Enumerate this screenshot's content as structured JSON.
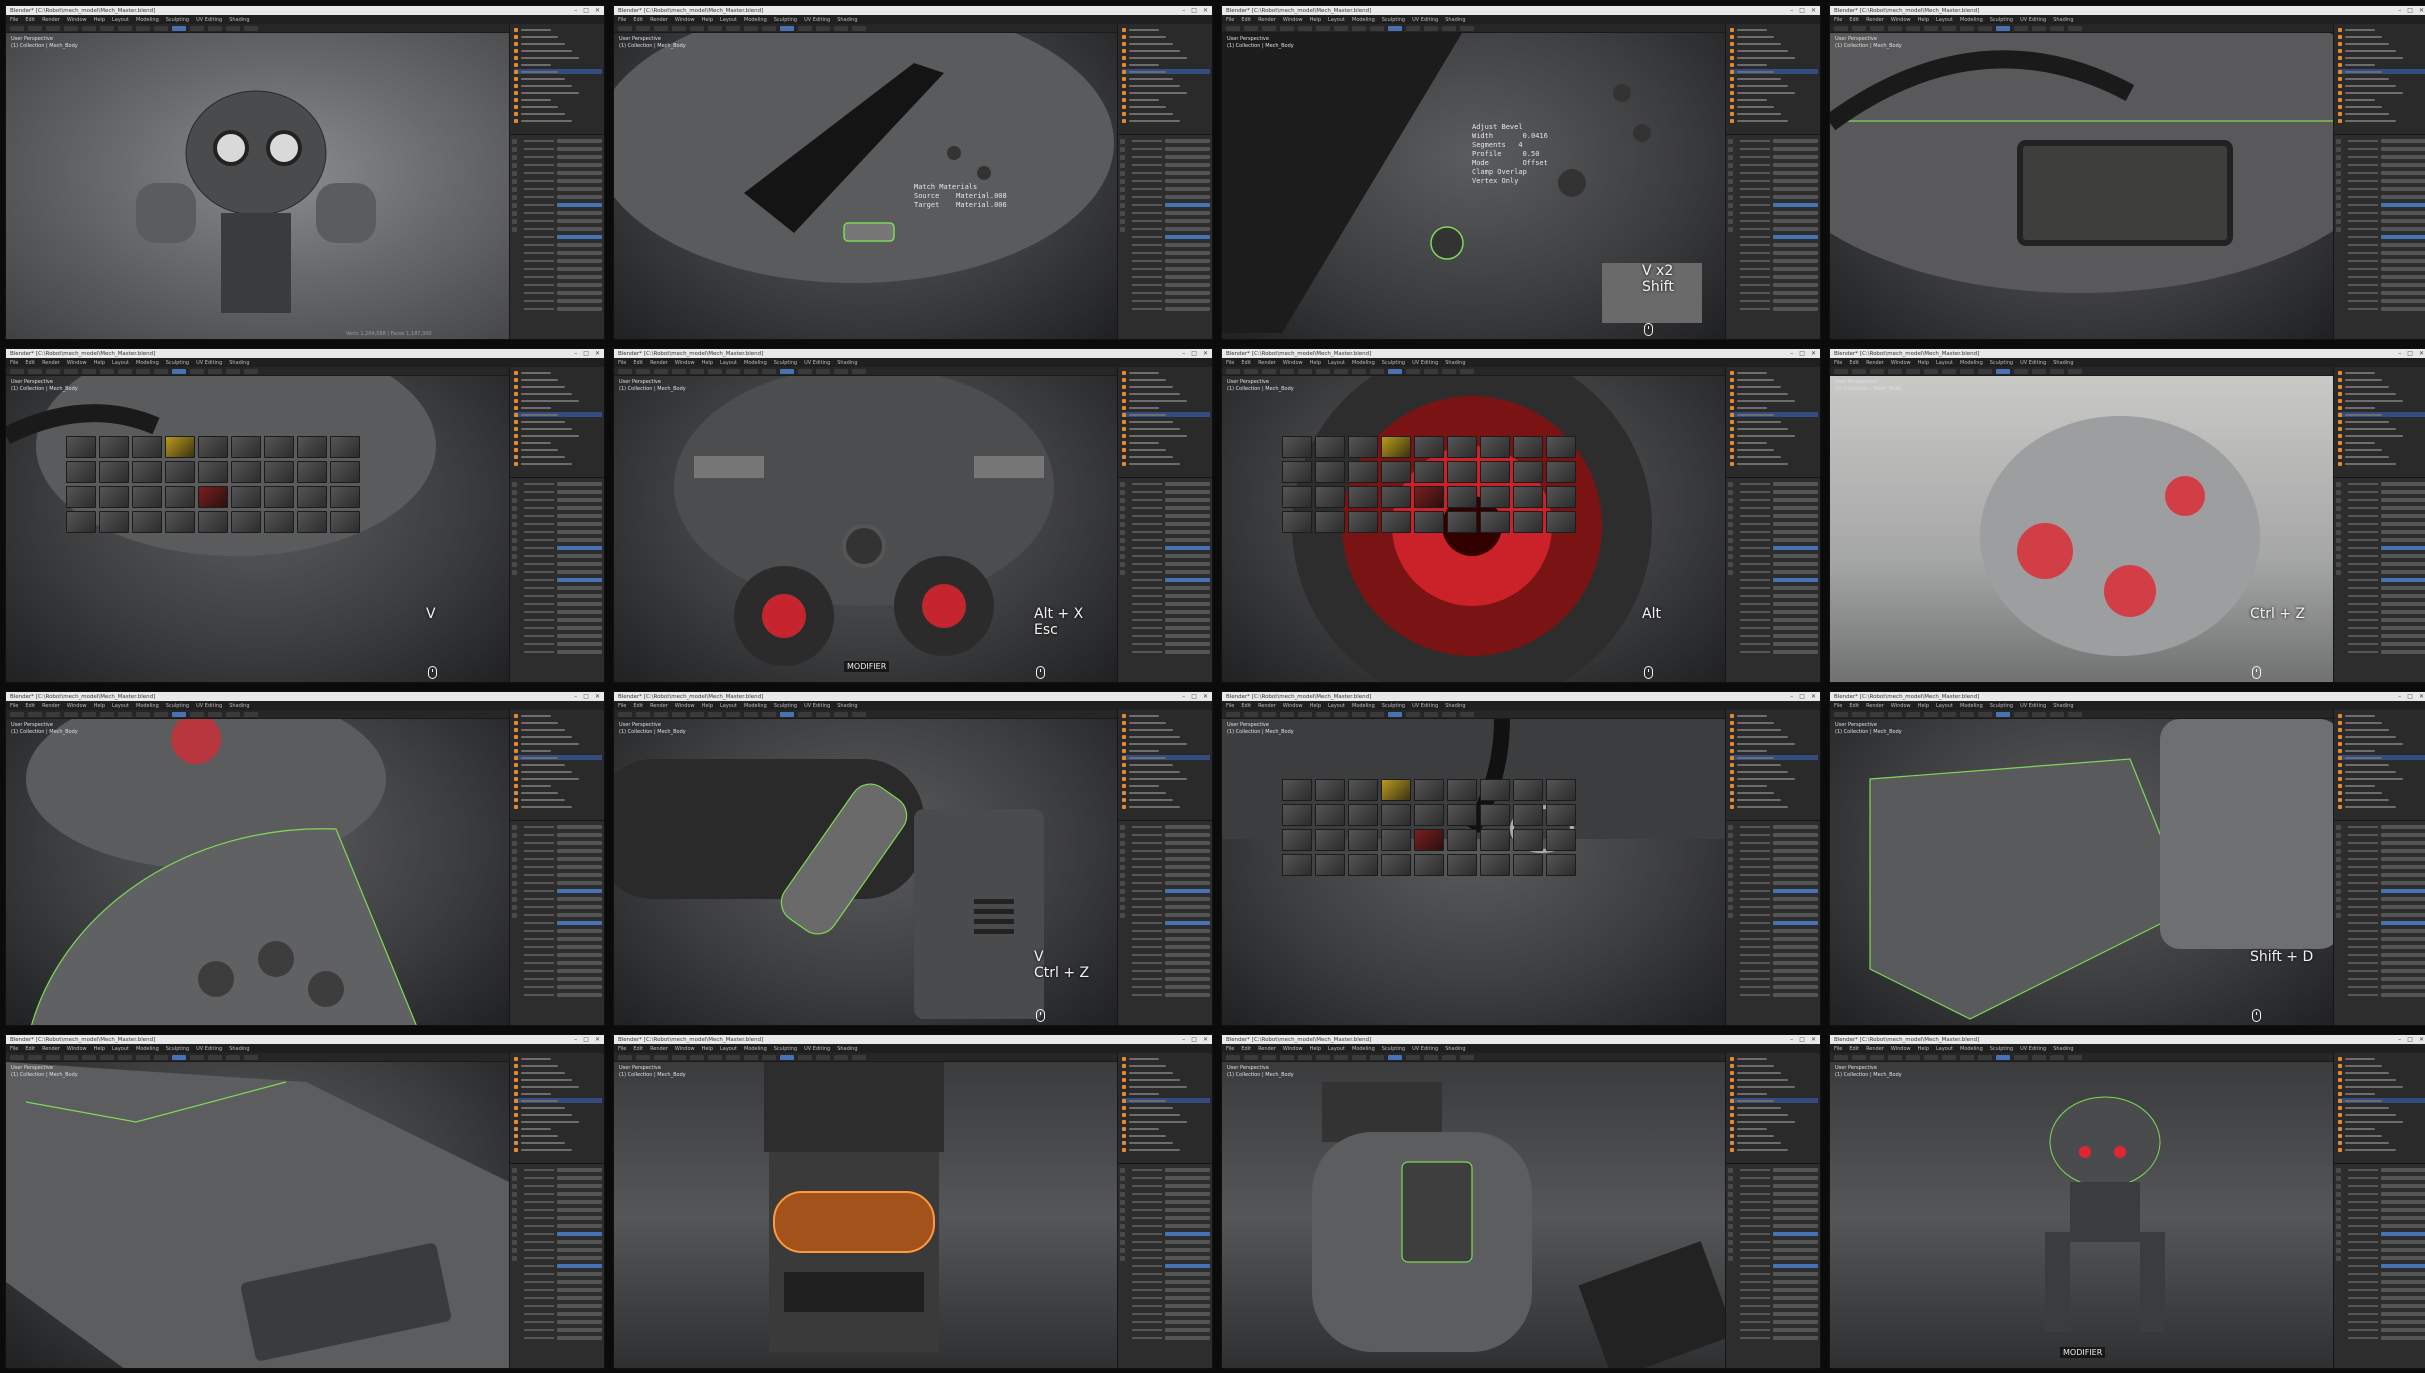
{
  "window_title": "Blender* [C:\\Robot\\mech_model\\Mech_Master.blend]",
  "menu": [
    "File",
    "Edit",
    "Render",
    "Window",
    "Help",
    "Layout",
    "Modeling",
    "Sculpting",
    "UV Editing",
    "Shading"
  ],
  "window_controls": [
    "–",
    "□",
    "✕"
  ],
  "viewport_info": [
    "User Perspective",
    "(1) Collection | Mech_Body"
  ],
  "stats_text": "Verts 1,204,588 | Faces 1,187,300",
  "colors": {
    "accent": "#4772b3",
    "outliner_select": "#334d80",
    "object_orange": "#e58a2e",
    "highlight_green": "#7ed957",
    "title_bg": "#e9e9e9",
    "red_glow": "#e0262f"
  },
  "panels": [
    {
      "id": "p1",
      "scene": "studio",
      "overlay": "",
      "hud": ""
    },
    {
      "id": "p2",
      "scene": "dark",
      "overlay": "",
      "hud": "Match Materials\nSource    Material.008\nTarget    Material.006"
    },
    {
      "id": "p3",
      "scene": "dark",
      "overlay": "V x2\nShift",
      "hud": "Adjust Bevel\nWidth       0.0416\nSegments   4\nProfile     0.50\nMode        Offset\nClamp Overlap\nVertex Only"
    },
    {
      "id": "p4",
      "scene": "dark",
      "overlay": "",
      "hud": ""
    },
    {
      "id": "p5",
      "scene": "dark",
      "overlay": "V",
      "hud": ""
    },
    {
      "id": "p6",
      "scene": "dark",
      "overlay": "Alt + X\nEsc",
      "hud": "",
      "badge": "MODIFIER"
    },
    {
      "id": "p7",
      "scene": "dark",
      "overlay": "Alt",
      "hud": ""
    },
    {
      "id": "p8",
      "scene": "light",
      "overlay": "Ctrl + Z",
      "hud": ""
    },
    {
      "id": "p9",
      "scene": "dark",
      "overlay": "",
      "hud": ""
    },
    {
      "id": "p10",
      "scene": "dark",
      "overlay": "V\nCtrl + Z",
      "hud": ""
    },
    {
      "id": "p11",
      "scene": "dark",
      "overlay": "",
      "hud": ""
    },
    {
      "id": "p12",
      "scene": "dark",
      "overlay": "Shift + D",
      "hud": ""
    },
    {
      "id": "p13",
      "scene": "dark",
      "overlay": "",
      "hud": ""
    },
    {
      "id": "p14",
      "scene": "floor",
      "overlay": "",
      "hud": ""
    },
    {
      "id": "p15",
      "scene": "floor",
      "overlay": "",
      "hud": ""
    },
    {
      "id": "p16",
      "scene": "floor",
      "overlay": "",
      "hud": "",
      "badge": "MODIFIER"
    }
  ]
}
